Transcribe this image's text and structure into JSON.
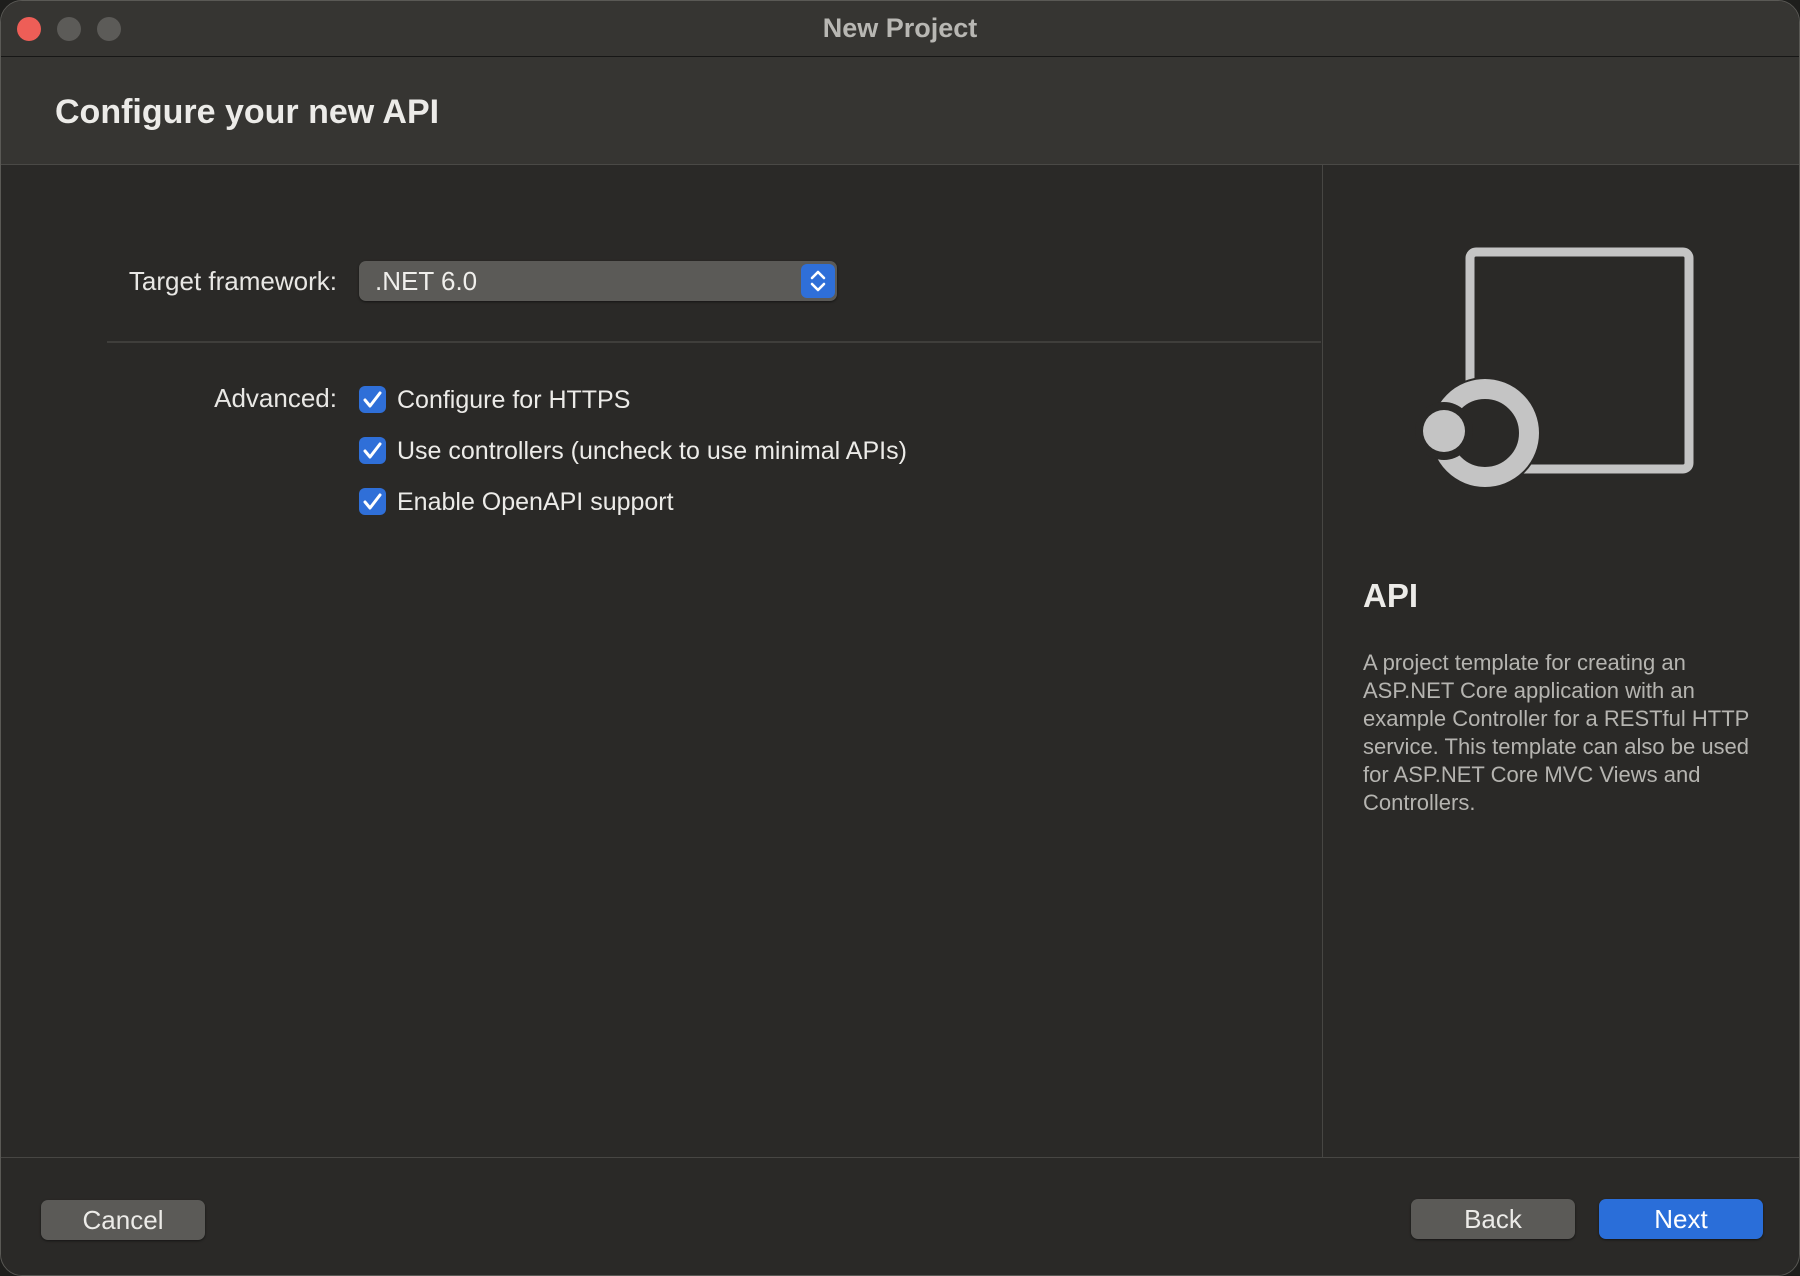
{
  "window": {
    "title": "New Project"
  },
  "header": {
    "title": "Configure your new API"
  },
  "form": {
    "target_framework_label": "Target framework:",
    "target_framework_value": ".NET 6.0",
    "advanced_label": "Advanced:",
    "options": [
      {
        "label": "Configure for HTTPS",
        "checked": true
      },
      {
        "label": "Use controllers (uncheck to use minimal APIs)",
        "checked": true
      },
      {
        "label": "Enable OpenAPI support",
        "checked": true
      }
    ]
  },
  "template": {
    "title": "API",
    "description": "A project template for creating an ASP.NET Core application with an example Controller for a RESTful HTTP service. This template can also be used for ASP.NET Core MVC Views and Controllers.",
    "icon": "api-template-icon"
  },
  "footer": {
    "cancel_label": "Cancel",
    "back_label": "Back",
    "next_label": "Next"
  },
  "colors": {
    "accent": "#2a6ed9",
    "close_button": "#ee5e57"
  }
}
